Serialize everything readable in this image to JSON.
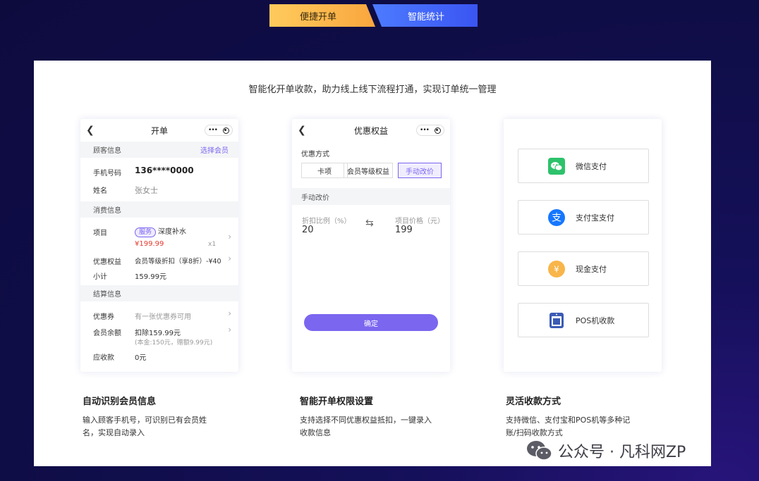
{
  "tabs": {
    "quick_order": "便捷开单",
    "smart_stats": "智能统计"
  },
  "headline": "智能化开单收款，助力线上线下流程打通，实现订单统一管理",
  "card1": {
    "title": "开单",
    "customer_section": "顾客信息",
    "select_member": "选择会员",
    "phone_label": "手机号码",
    "phone_value": "136****0000",
    "name_label": "姓名",
    "name_value": "张女士",
    "consume_section": "消费信息",
    "item_label": "项目",
    "item_badge": "服务",
    "item_name": "深度补水",
    "item_price": "¥199.99",
    "item_qty": "x1",
    "benefit_label": "优惠权益",
    "benefit_value": "会员等级折扣（享8折）-¥40",
    "subtotal_label": "小计",
    "subtotal_value": "159.99元",
    "settle_section": "结算信息",
    "coupon_label": "优惠券",
    "coupon_value": "有一张优惠券可用",
    "balance_label": "会员余额",
    "balance_value": "扣除159.99元",
    "balance_note": "(本金:150元，赠额9.99元)",
    "due_label": "应收款",
    "due_value": "0元"
  },
  "card2": {
    "title": "优惠权益",
    "method_label": "优惠方式",
    "options": [
      "卡项",
      "会员等级权益",
      "手动改价"
    ],
    "manual_section": "手动改价",
    "discount_label": "折扣比例（%）",
    "discount_value": "20",
    "price_label": "项目价格（元）",
    "price_value": "199",
    "confirm": "确定"
  },
  "card3": {
    "payments": [
      {
        "label": "微信支付",
        "icon": "wechat-icon",
        "color": "#2dc26b"
      },
      {
        "label": "支付宝支付",
        "icon": "alipay-icon",
        "color": "#1677ff"
      },
      {
        "label": "现金支付",
        "icon": "yuan-icon",
        "color": "#f8b54a"
      },
      {
        "label": "POS机收款",
        "icon": "pos-icon",
        "color": "#3b5bb5"
      }
    ]
  },
  "features": [
    {
      "title": "自动识别会员信息",
      "desc": "输入顾客手机号，可识别已有会员姓名，实现自动录入"
    },
    {
      "title": "智能开单权限设置",
      "desc": "支持选择不同优惠权益抵扣，一键录入收款信息"
    },
    {
      "title": "灵活收款方式",
      "desc": "支持微信、支付宝和POS机等多种记账/扫码收款方式"
    }
  ],
  "watermark": "公众号 · 凡科网ZP",
  "colors": {
    "accent": "#7b66f0",
    "price_red": "#e43a2f",
    "tab_orange": "#f9a63e",
    "tab_blue": "#3a55f2"
  }
}
